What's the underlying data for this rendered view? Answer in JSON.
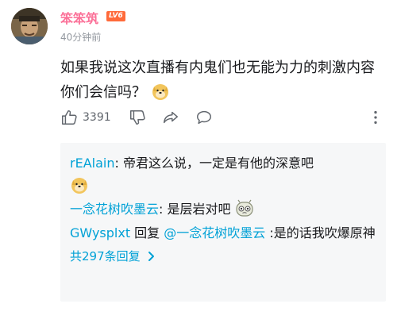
{
  "comment": {
    "username": "笨笨筑",
    "level": "LV6",
    "time": "40分钟前",
    "text": "如果我说这次直播有内鬼们也无能为力的刺激内容你们会信吗？",
    "likes": "3391"
  },
  "replies": [
    {
      "name": "rEAlain",
      "sep": ": ",
      "text": "帝君这么说，一定是有他的深意吧"
    },
    {
      "name": "一念花树吹墨云",
      "sep": ": ",
      "text": "是层岩对吧"
    },
    {
      "name": "GWysplxt",
      "mid": " 回复 ",
      "mention": "@一念花树吹墨云",
      "text": " :是的话我吹爆原神"
    }
  ],
  "more_replies": "共297条回复",
  "colors": {
    "accent": "#00a1d6",
    "username": "#fb7299",
    "level": "#ff6a3a"
  },
  "icons": [
    "thumb-up-icon",
    "thumb-down-icon",
    "share-icon",
    "comment-icon",
    "more-vertical-icon",
    "doge-emoji",
    "confused-emoji",
    "chevron-right-icon"
  ]
}
